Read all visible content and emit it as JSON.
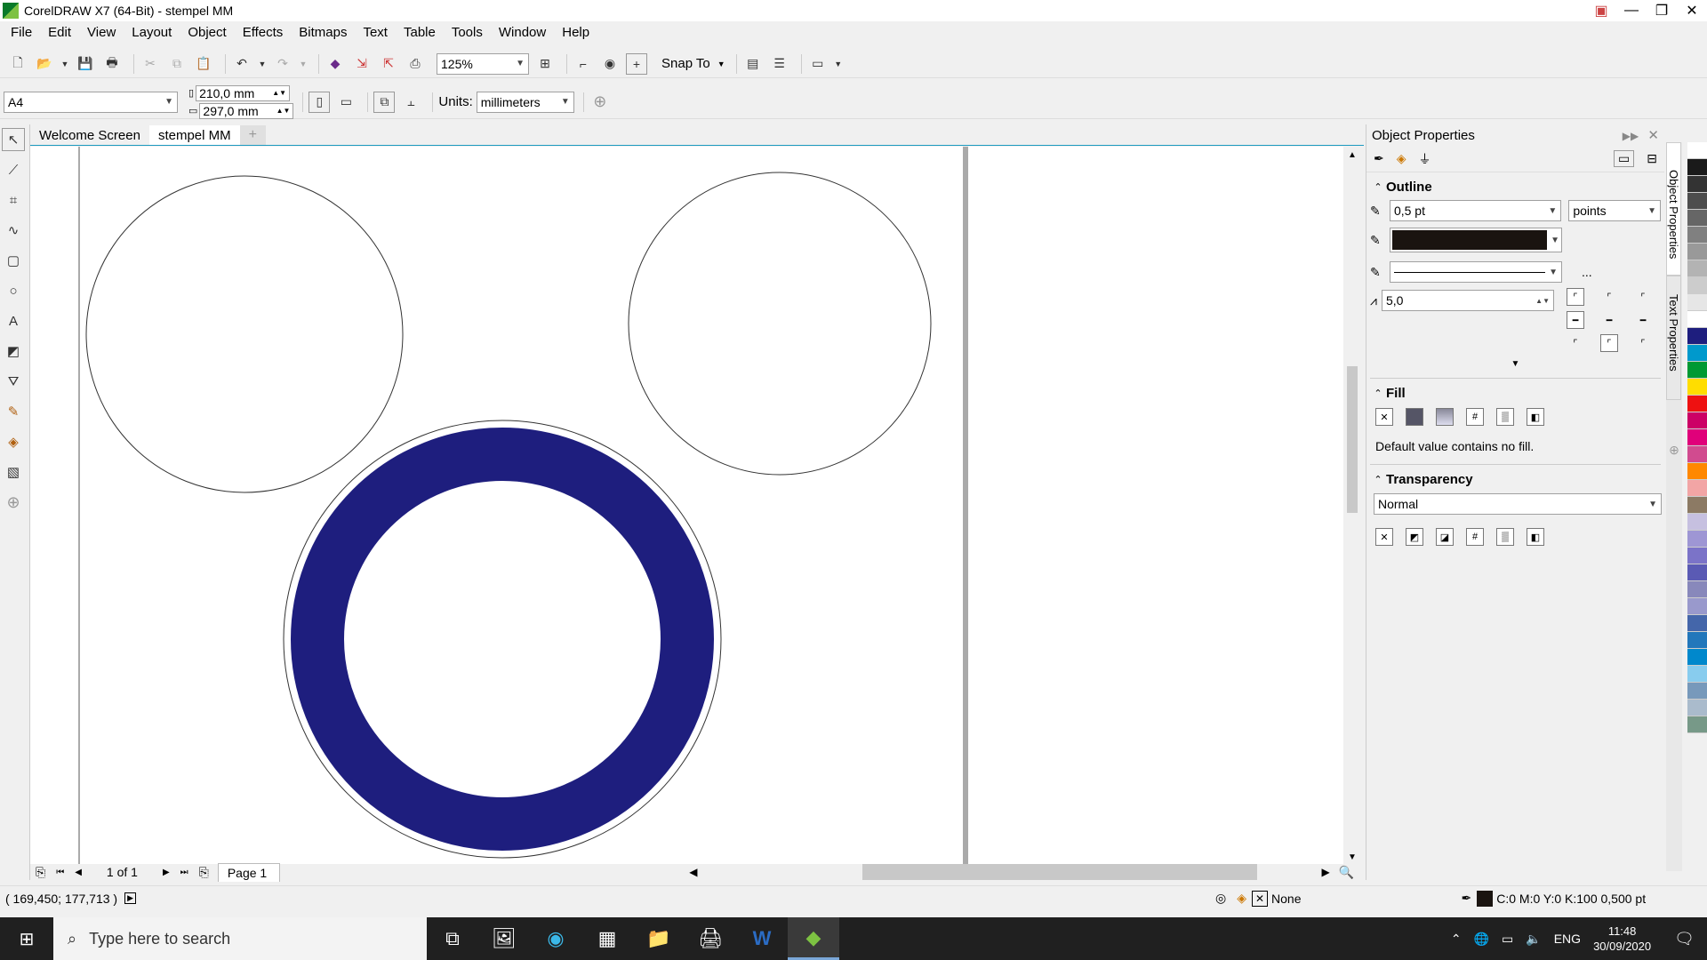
{
  "window": {
    "title": "CorelDRAW X7 (64-Bit) - stempel MM"
  },
  "menu": [
    {
      "label": "File"
    },
    {
      "label": "Edit"
    },
    {
      "label": "View"
    },
    {
      "label": "Layout"
    },
    {
      "label": "Object"
    },
    {
      "label": "Effects"
    },
    {
      "label": "Bitmaps"
    },
    {
      "label": "Text"
    },
    {
      "label": "Table"
    },
    {
      "label": "Tools"
    },
    {
      "label": "Window"
    },
    {
      "label": "Help"
    }
  ],
  "toolbar": {
    "zoom": "125%",
    "snap_to": "Snap To"
  },
  "property_bar": {
    "page_size": "A4",
    "width": "210,0 mm",
    "height": "297,0 mm",
    "units_label": "Units:",
    "units": "millimeters"
  },
  "tabs": [
    {
      "label": "Welcome Screen"
    },
    {
      "label": "stempel MM"
    }
  ],
  "page_nav": {
    "counter": "1 of 1",
    "page_tab": "Page 1"
  },
  "panel": {
    "title": "Object Properties",
    "outline": {
      "title": "Outline",
      "width": "0,5 pt",
      "units": "points",
      "color": "#1a1410",
      "miter": "5,0",
      "more": "..."
    },
    "fill": {
      "title": "Fill",
      "note": "Default value contains no fill."
    },
    "transparency": {
      "title": "Transparency",
      "mode": "Normal"
    },
    "dock_tabs": [
      "Object Properties",
      "Text Properties"
    ]
  },
  "canvas": {
    "ring_color": "#1e1e7e"
  },
  "status": {
    "coords": "( 169,450; 177,713 )",
    "fill_text": "None",
    "outline_text": "C:0 M:0 Y:0 K:100  0,500 pt",
    "outline_color": "#1a1410"
  },
  "taskbar": {
    "search_placeholder": "Type here to search",
    "lang": "ENG",
    "time": "11:48",
    "date": "30/09/2020"
  },
  "palette": [
    "#ffffff",
    "#1a1a1a",
    "#333333",
    "#4d4d4d",
    "#666666",
    "#808080",
    "#999999",
    "#b3b3b3",
    "#cccccc",
    "#e6e6e6",
    "#ffffff",
    "#1e1e7e",
    "#0099cc",
    "#009933",
    "#ffdd00",
    "#ee1111",
    "#cc0066",
    "#e0007a",
    "#d14b8f",
    "#ff8800",
    "#f2a5a5",
    "#8c7a64",
    "#c6c0e0",
    "#9e96d4",
    "#7b73c8",
    "#5a5ab4",
    "#8888bb",
    "#9999cc",
    "#4466aa",
    "#2277bb",
    "#0088cc",
    "#88ccee",
    "#7799bb",
    "#aabbcc",
    "#779988"
  ]
}
